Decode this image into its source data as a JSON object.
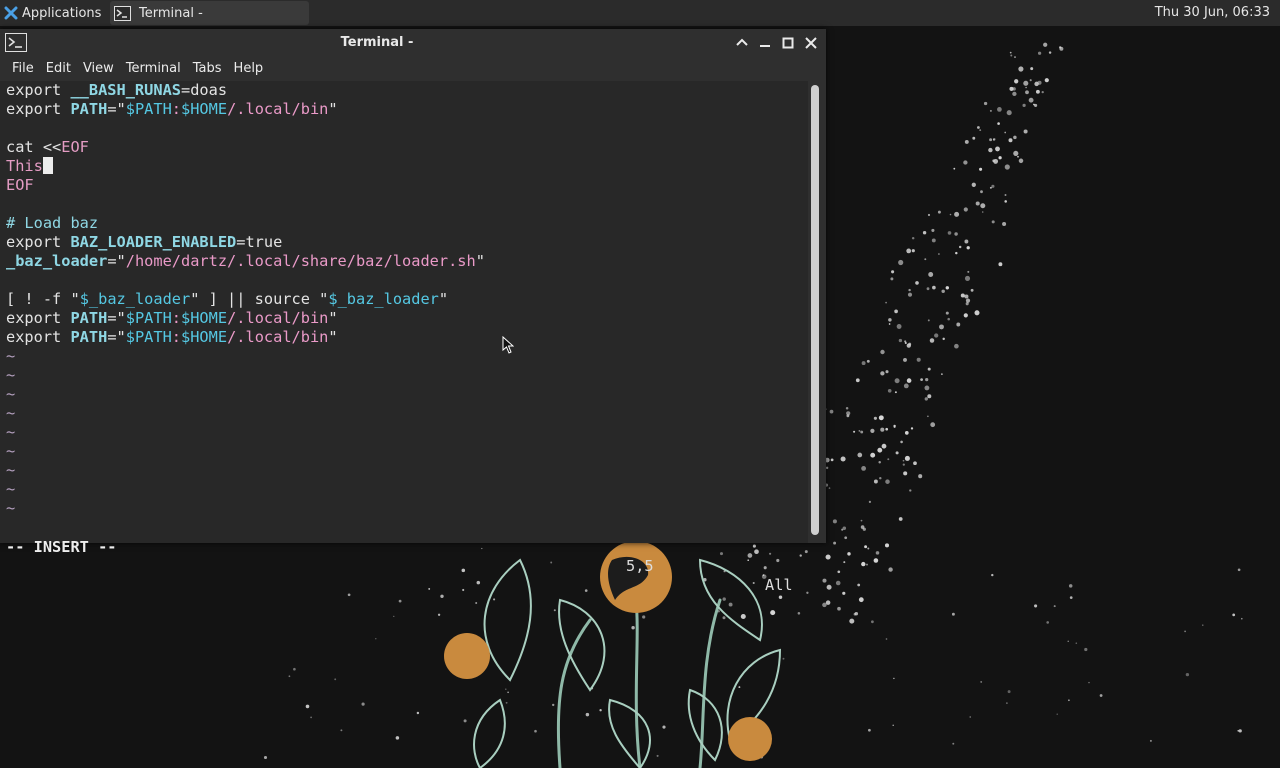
{
  "panel": {
    "apps_label": "Applications",
    "apps_icon": "xfce-logo-icon",
    "task_title": "Terminal -",
    "clock": "Thu 30 Jun, 06:33"
  },
  "window": {
    "title": "Terminal -",
    "icon": "terminal-icon",
    "buttons": [
      "shade-icon",
      "minimize-icon",
      "maximize-icon",
      "close-icon"
    ]
  },
  "menu": [
    "File",
    "Edit",
    "View",
    "Terminal",
    "Tabs",
    "Help"
  ],
  "editor": {
    "lines": [
      [
        {
          "t": "export ",
          "c": "kw"
        },
        {
          "t": "__BASH_RUNAS",
          "c": "var"
        },
        {
          "t": "=doas",
          "c": "kw"
        }
      ],
      [
        {
          "t": "export ",
          "c": "kw"
        },
        {
          "t": "PATH",
          "c": "var"
        },
        {
          "t": "=\"",
          "c": "kw"
        },
        {
          "t": "$PATH",
          "c": "svar"
        },
        {
          "t": ":",
          "c": "str"
        },
        {
          "t": "$HOME",
          "c": "svar"
        },
        {
          "t": "/.local/bin",
          "c": "str"
        },
        {
          "t": "\"",
          "c": "kw"
        }
      ],
      [],
      [
        {
          "t": "cat <<",
          "c": "kw"
        },
        {
          "t": "EOF",
          "c": "hd"
        }
      ],
      [
        {
          "t": "This",
          "c": "hd"
        },
        {
          "cursor": true
        }
      ],
      [
        {
          "t": "EOF",
          "c": "hd"
        }
      ],
      [],
      [
        {
          "t": "# Load baz",
          "c": "cmt"
        }
      ],
      [
        {
          "t": "export ",
          "c": "kw"
        },
        {
          "t": "BAZ_LOADER_ENABLED",
          "c": "var"
        },
        {
          "t": "=true",
          "c": "kw"
        }
      ],
      [
        {
          "t": "_baz_loader",
          "c": "var"
        },
        {
          "t": "=\"",
          "c": "kw"
        },
        {
          "t": "/home/dartz/.local/share/baz/loader.sh",
          "c": "str"
        },
        {
          "t": "\"",
          "c": "kw"
        }
      ],
      [],
      [
        {
          "t": "[ ! -f \"",
          "c": "kw"
        },
        {
          "t": "$_baz_loader",
          "c": "svar"
        },
        {
          "t": "\" ] || source \"",
          "c": "kw"
        },
        {
          "t": "$_baz_loader",
          "c": "svar"
        },
        {
          "t": "\"",
          "c": "kw"
        }
      ],
      [
        {
          "t": "export ",
          "c": "kw"
        },
        {
          "t": "PATH",
          "c": "var"
        },
        {
          "t": "=\"",
          "c": "kw"
        },
        {
          "t": "$PATH",
          "c": "svar"
        },
        {
          "t": ":",
          "c": "str"
        },
        {
          "t": "$HOME",
          "c": "svar"
        },
        {
          "t": "/.local/bin",
          "c": "str"
        },
        {
          "t": "\"",
          "c": "kw"
        }
      ],
      [
        {
          "t": "export ",
          "c": "kw"
        },
        {
          "t": "PATH",
          "c": "var"
        },
        {
          "t": "=\"",
          "c": "kw"
        },
        {
          "t": "$PATH",
          "c": "svar"
        },
        {
          "t": ":",
          "c": "str"
        },
        {
          "t": "$HOME",
          "c": "svar"
        },
        {
          "t": "/.local/bin",
          "c": "str"
        },
        {
          "t": "\"",
          "c": "kw"
        }
      ],
      [
        {
          "t": "~",
          "c": "tilde"
        }
      ],
      [
        {
          "t": "~",
          "c": "tilde"
        }
      ],
      [
        {
          "t": "~",
          "c": "tilde"
        }
      ],
      [
        {
          "t": "~",
          "c": "tilde"
        }
      ],
      [
        {
          "t": "~",
          "c": "tilde"
        }
      ],
      [
        {
          "t": "~",
          "c": "tilde"
        }
      ],
      [
        {
          "t": "~",
          "c": "tilde"
        }
      ],
      [
        {
          "t": "~",
          "c": "tilde"
        }
      ],
      [
        {
          "t": "~",
          "c": "tilde"
        }
      ]
    ],
    "status": {
      "mode": "-- INSERT --",
      "position": "5,5",
      "scroll": "All"
    }
  },
  "colors": {
    "panel_bg": "#2b2b2b",
    "window_bg": "#2f2f2f",
    "terminal_bg": "#282828",
    "variable": "#8fd7e4",
    "string": "#ea9ac8",
    "shell_var": "#55c8e3"
  }
}
